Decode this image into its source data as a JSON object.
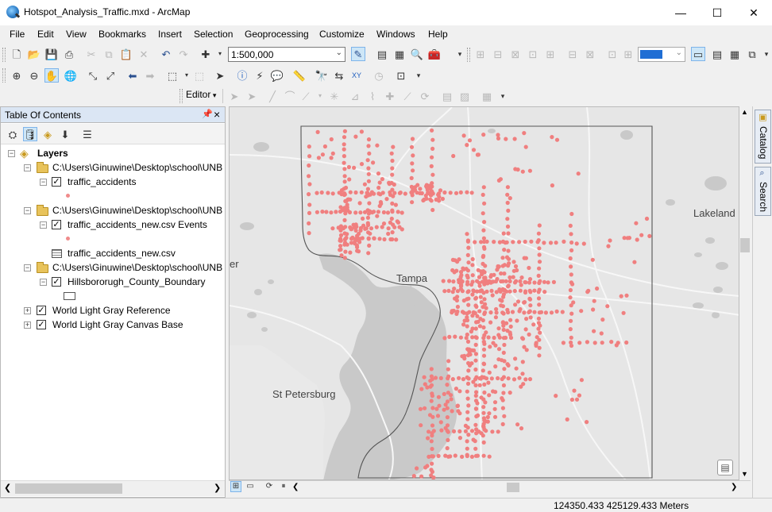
{
  "window": {
    "title": "Hotspot_Analysis_Traffic.mxd - ArcMap",
    "minimize": "—",
    "maximize": "☐",
    "close": "✕"
  },
  "menu": [
    "File",
    "Edit",
    "View",
    "Bookmarks",
    "Insert",
    "Selection",
    "Geoprocessing",
    "Customize",
    "Windows",
    "Help"
  ],
  "toolbar": {
    "scale": "1:500,000",
    "editor_label": "Editor"
  },
  "toc": {
    "title": "Table Of Contents",
    "root": "Layers",
    "groups": [
      {
        "path": "C:\\Users\\Ginuwine\\Desktop\\school\\UNB",
        "layer": "traffic_accidents"
      },
      {
        "path": "C:\\Users\\Ginuwine\\Desktop\\school\\UNB",
        "layer": "traffic_accidents_new.csv Events",
        "table": "traffic_accidents_new.csv"
      },
      {
        "path": "C:\\Users\\Ginuwine\\Desktop\\school\\UNB",
        "layer": "Hillsbororugh_County_Boundary"
      }
    ],
    "basemaps": [
      "World Light Gray Reference",
      "World Light Gray Canvas Base"
    ]
  },
  "map": {
    "labels": {
      "lakeland": "Lakeland",
      "tampa": "Tampa",
      "stpete": "St Petersburg",
      "cut": "er"
    },
    "point_color": "#f07f7f",
    "boundary_color": "#555555",
    "water_color": "#c9c9c9",
    "land_color": "#e6e6e6"
  },
  "dock": {
    "catalog": "Catalog",
    "search": "Search"
  },
  "status": {
    "coords": "124350.433  425129.433 Meters"
  }
}
